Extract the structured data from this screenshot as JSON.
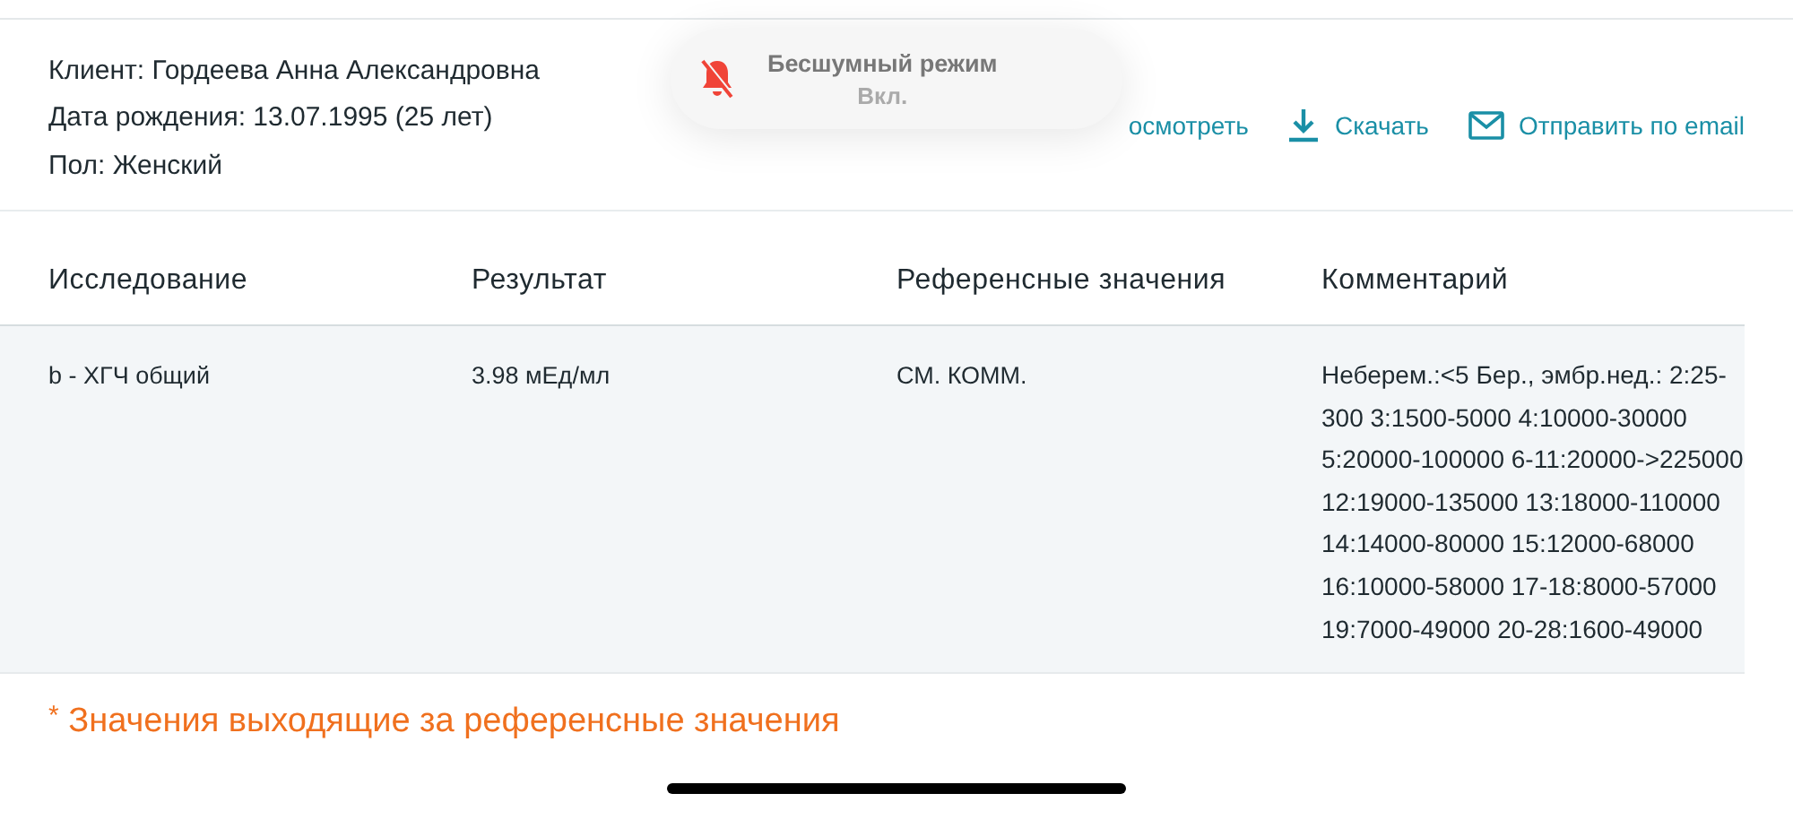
{
  "client": {
    "lines": [
      "Клиент: Гордеева Анна Александровна",
      "Дата рождения: 13.07.1995 (25 лет)",
      "Пол: Женский"
    ]
  },
  "actions": [
    {
      "kind": "view",
      "label": "осмотреть"
    },
    {
      "kind": "download",
      "label": "Скачать"
    },
    {
      "kind": "email",
      "label": "Отправить по email"
    }
  ],
  "toast": {
    "title": "Бесшумный режим",
    "subtitle": "Вкл."
  },
  "table": {
    "columns": [
      "Исследование",
      "Результат",
      "Референсные значения",
      "Комментарий"
    ],
    "rows": [
      [
        "b - ХГЧ общий",
        "3.98 мЕд/мл",
        "СМ. КОММ.",
        "Неберем.:<5 Бер., эмбр.нед.: 2:25-300 3:1500-5000 4:10000-30000 5:20000-100000 6-11:20000->225000 12:19000-135000 13:18000-110000 14:14000-80000 15:12000-68000 16:10000-58000 17-18:8000-57000 19:7000-49000 20-28:1600-49000"
      ]
    ]
  },
  "note": {
    "mark": "*",
    "text": "Значения выходящие за референсные значения"
  }
}
